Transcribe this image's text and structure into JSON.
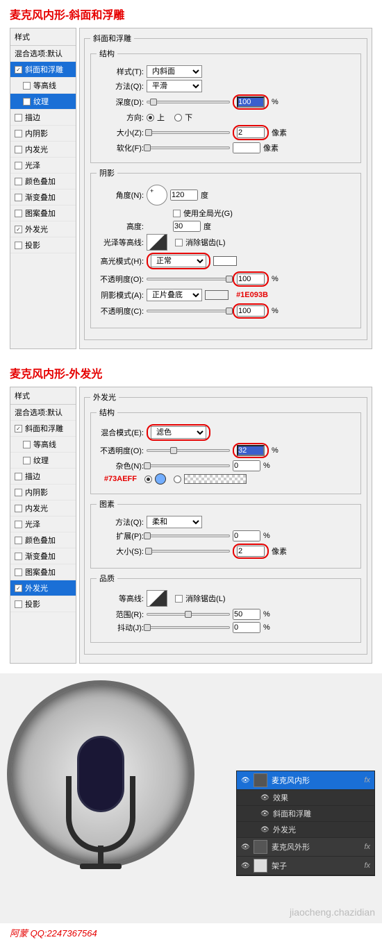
{
  "section1": {
    "title": "麦克风内形-斜面和浮雕",
    "styles_header": "样式",
    "blend_options": "混合选项:默认",
    "items": [
      {
        "label": "斜面和浮雕",
        "checked": true,
        "active": true
      },
      {
        "label": "等高线",
        "checked": false,
        "indent": true
      },
      {
        "label": "纹理",
        "checked": false,
        "indent": true,
        "sub_active": true
      },
      {
        "label": "描边",
        "checked": false
      },
      {
        "label": "内阴影",
        "checked": false
      },
      {
        "label": "内发光",
        "checked": false
      },
      {
        "label": "光泽",
        "checked": false
      },
      {
        "label": "颜色叠加",
        "checked": false
      },
      {
        "label": "渐变叠加",
        "checked": false
      },
      {
        "label": "图案叠加",
        "checked": false
      },
      {
        "label": "外发光",
        "checked": true
      },
      {
        "label": "投影",
        "checked": false
      }
    ],
    "legend_main": "斜面和浮雕",
    "legend_struct": "结构",
    "style_label": "样式(T):",
    "style_val": "内斜面",
    "method_label": "方法(Q):",
    "method_val": "平滑",
    "depth_label": "深度(D):",
    "depth_val": "100",
    "pct": "%",
    "dir_label": "方向:",
    "dir_up": "上",
    "dir_down": "下",
    "size_label": "大小(Z):",
    "size_val": "2",
    "px": "像素",
    "soften_label": "软化(F):",
    "soften_val": "",
    "legend_shadow": "阴影",
    "angle_label": "角度(N):",
    "angle_val": "120",
    "deg": "度",
    "global_label": "使用全局光(G)",
    "altitude_label": "高度:",
    "altitude_val": "30",
    "gloss_label": "光泽等高线:",
    "aa_label": "消除锯齿(L)",
    "hilite_label": "高光模式(H):",
    "hilite_val": "正常",
    "opacity_label": "不透明度(O):",
    "opacity_val": "100",
    "shadow_mode_label": "阴影模式(A):",
    "shadow_mode_val": "正片叠底",
    "shadow_color": "#1E093B",
    "shadow_hex": "#1E093B",
    "opacity2_label": "不透明度(C):",
    "opacity2_val": "100"
  },
  "section2": {
    "title": "麦克风内形-外发光",
    "styles_header": "样式",
    "blend_options": "混合选项:默认",
    "items": [
      {
        "label": "斜面和浮雕",
        "checked": true
      },
      {
        "label": "等高线",
        "checked": false,
        "indent": true
      },
      {
        "label": "纹理",
        "checked": false,
        "indent": true
      },
      {
        "label": "描边",
        "checked": false
      },
      {
        "label": "内阴影",
        "checked": false
      },
      {
        "label": "内发光",
        "checked": false
      },
      {
        "label": "光泽",
        "checked": false
      },
      {
        "label": "颜色叠加",
        "checked": false
      },
      {
        "label": "渐变叠加",
        "checked": false
      },
      {
        "label": "图案叠加",
        "checked": false
      },
      {
        "label": "外发光",
        "checked": true,
        "active": true
      },
      {
        "label": "投影",
        "checked": false
      }
    ],
    "legend_main": "外发光",
    "legend_struct": "结构",
    "blend_label": "混合模式(E):",
    "blend_val": "滤色",
    "opacity_label": "不透明度(O):",
    "opacity_val": "32",
    "pct": "%",
    "noise_label": "杂色(N):",
    "noise_val": "0",
    "color_hex": "#73AEFF",
    "legend_elem": "图素",
    "method_label": "方法(Q):",
    "method_val": "柔和",
    "spread_label": "扩展(P):",
    "spread_val": "0",
    "size_label": "大小(S):",
    "size_val": "2",
    "px": "像素",
    "legend_qual": "品质",
    "contour_label": "等高线:",
    "aa_label": "消除锯齿(L)",
    "range_label": "范围(R):",
    "range_val": "50",
    "jitter_label": "抖动(J):",
    "jitter_val": "0"
  },
  "layers": {
    "r1": "麦克风内形",
    "fx": "效果",
    "fx1": "斜面和浮雕",
    "fx2": "外发光",
    "r2": "麦克风外形",
    "r3": "架子",
    "fxlabel": "fx"
  },
  "credit": "阿蒙 QQ:2247367564",
  "wm": "jiaocheng.chazidian"
}
